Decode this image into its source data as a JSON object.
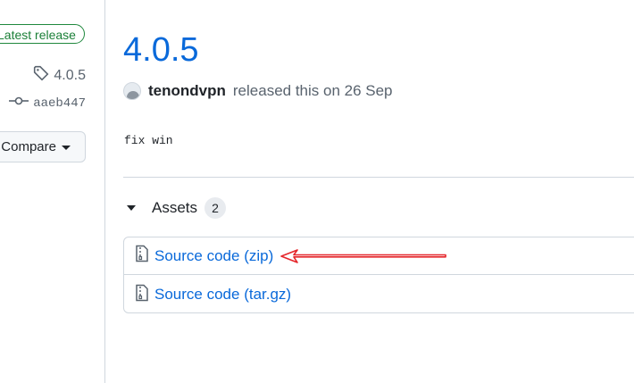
{
  "sidebar": {
    "latest_badge": "Latest release",
    "tag": "4.0.5",
    "commit": "aaeb447",
    "compare_label": "Compare"
  },
  "release": {
    "title": "4.0.5",
    "author": "tenondvpn",
    "released_text": "released this on 26 Sep",
    "notes": "fix win"
  },
  "assets": {
    "label": "Assets",
    "count": "2",
    "items": [
      {
        "name": "Source code",
        "suffix": "(zip)",
        "icon": "file-zip-icon"
      },
      {
        "name": "Source code",
        "suffix": "(tar.gz)",
        "icon": "file-zip-icon"
      }
    ]
  },
  "annotation": {
    "arrow_color": "#e5262b"
  }
}
